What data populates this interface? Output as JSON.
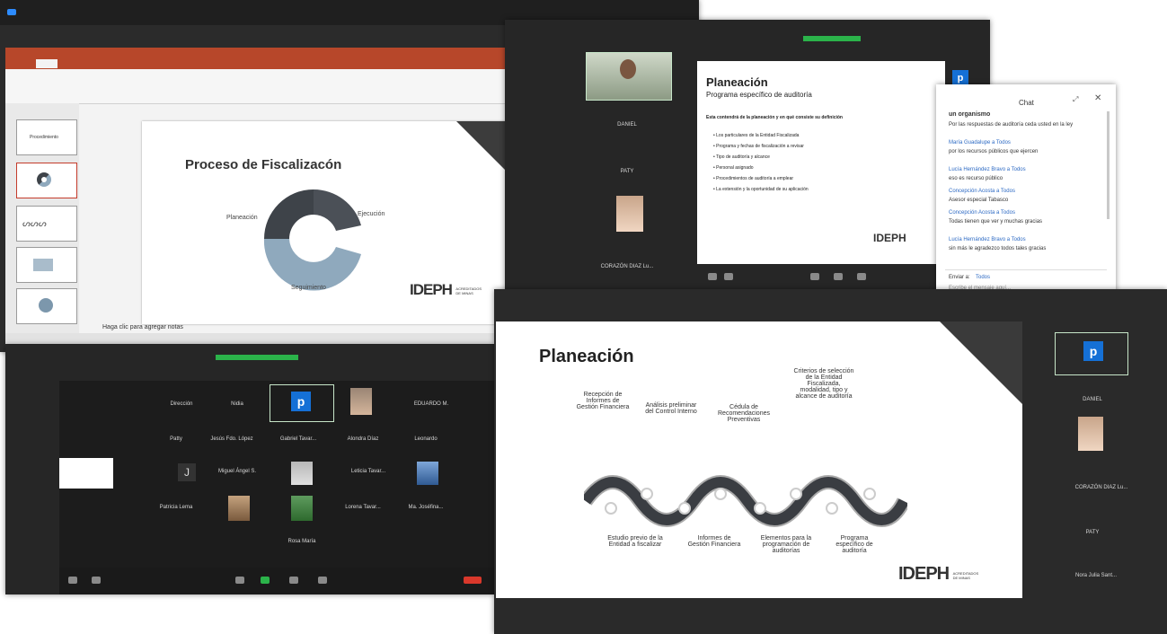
{
  "colors": {
    "accent_green": "#2bb34a",
    "zoom_dark": "#2b2b2b",
    "ppt_red": "#b7472a",
    "zoom_blue": "#1570d6",
    "chart_dark": "#3e4349",
    "chart_light": "#8fa9bd",
    "end_red": "#d9382b"
  },
  "icons": [
    "mic-icon",
    "video-icon",
    "participants-icon",
    "share-screen-icon",
    "record-icon",
    "reactions-icon",
    "end-meeting-icon",
    "close-icon",
    "expand-icon"
  ],
  "ppt": {
    "slide_title": "Proceso de Fiscalizacón",
    "label_planeacion": "Planeación",
    "label_ejecucion": "Ejecución",
    "label_seguimiento": "Seguimiento",
    "notes_placeholder": "Haga clic para agregar notas",
    "thumb_title": "Procedimiento",
    "logo": "IDEPH",
    "logo_sub": "ACREDITADOS DE MINAS"
  },
  "zoom_gallery": {
    "row1": [
      "Dirección",
      "Nidia",
      "",
      "",
      "EDUARDO M."
    ],
    "row2": [
      "Patty",
      "Jesús Fdo. López",
      "Gabriel Tavar...",
      "Alondra Díaz",
      "Leonardo"
    ],
    "row3": [
      "",
      "Miguel Ángel S.",
      "",
      "Leticia Tavar...",
      ""
    ],
    "row4": [
      "Patricia Lema",
      "",
      "",
      "Lorena Tavar...",
      "Ma. Joséfina..."
    ],
    "row5": [
      "Rosa María"
    ],
    "avatar_letter_p": "p",
    "avatar_letter_j": "J"
  },
  "zoom_top_right": {
    "participants": [
      "DANIEL",
      "PATY",
      "CORAZÓN DIAZ Lu..."
    ],
    "slide_title": "Planeación",
    "slide_subtitle": "Programa específico de auditoría",
    "slide_intro": "Esta contendrá de la planeación y en qué consiste su definición",
    "bullets": [
      "Los particulares de la Entidad Fiscalizada",
      "Programa y fechas de fiscalización a revisar",
      "Tipo de auditoría y alcance",
      "Personal asignado",
      "Procedimientos de auditoría a emplear",
      "La extensión y la oportunidad de su aplicación"
    ],
    "avatar_letter": "p"
  },
  "chat": {
    "header": "Chat",
    "messages": [
      {
        "from": "un organismo",
        "text": ""
      },
      {
        "from": "",
        "text": "Por las respuestas de auditoría ceda usted en la ley"
      },
      {
        "from": "María Guadalupe a Todos",
        "text": "por los recursos públicos que ejercen"
      },
      {
        "from": "Lucía Hernández Bravo a Todos",
        "text": "eso es recurso público"
      },
      {
        "from": "Concepción Acosta a Todos",
        "text": "Asesor especial Tabasco"
      },
      {
        "from": "Concepción Acosta a Todos",
        "text": "Todas tienen que ver y muchas gracias"
      },
      {
        "from": "Lucía Hernández Bravo a Todos",
        "text": "sin más le agradezco todos tales gracias"
      }
    ],
    "to_label": "Enviar a:",
    "to_value": "Todos",
    "input_placeholder": "Escribe el mensaje aquí..."
  },
  "planeacion_slide": {
    "title": "Planeación",
    "top_labels": [
      "Recepción de Informes de Gestión Financiera",
      "Análisis preliminar del Control Interno",
      "Cédula de Recomendaciones Preventivas",
      "Criterios de selección de la Entidad Fiscalizada, modalidad, tipo y alcance de auditoría"
    ],
    "bottom_labels": [
      "Estudio previo de la Entidad a fiscalizar",
      "Informes de Gestión Financiera",
      "Elementos para la programación de auditorías",
      "Programa específico de auditoría"
    ],
    "logo": "IDEPH",
    "logo_sub": "ACREDITADOS DE MINAS"
  },
  "zoom_bottom_right": {
    "participants": [
      "DANIEL",
      "CORAZÓN DIAZ Lu...",
      "PATY",
      "Nora Julia Sant..."
    ],
    "avatar_letter": "p"
  }
}
